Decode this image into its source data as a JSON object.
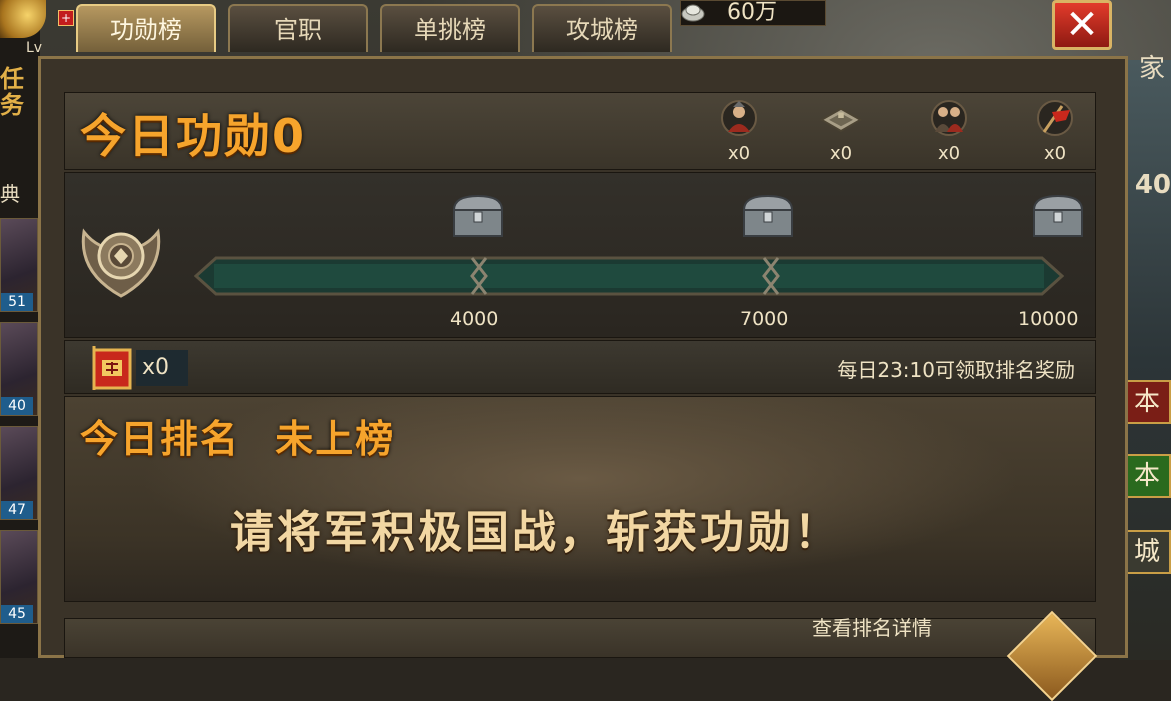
{
  "tabs": [
    {
      "label": "功勋榜",
      "active": true
    },
    {
      "label": "官职",
      "active": false
    },
    {
      "label": "单挑榜",
      "active": false
    },
    {
      "label": "攻城榜",
      "active": false
    }
  ],
  "resource": {
    "value": "60万"
  },
  "left_bar": {
    "level_text": "Lv",
    "task_text": "任务",
    "dian_text": "典",
    "plus": "+",
    "heroes": [
      {
        "level": "51"
      },
      {
        "level": "40"
      },
      {
        "level": "47"
      },
      {
        "level": "45"
      }
    ]
  },
  "right_bar": {
    "top_char": "家",
    "level": "40",
    "tags": [
      "本",
      "本",
      "城"
    ]
  },
  "merit": {
    "title": "今日功勋",
    "value": "0"
  },
  "stats": [
    {
      "icon": "general-icon",
      "count": "x0"
    },
    {
      "icon": "fortress-icon",
      "count": "x0"
    },
    {
      "icon": "soldiers-icon",
      "count": "x0"
    },
    {
      "icon": "war-flag-icon",
      "count": "x0"
    }
  ],
  "progress": {
    "current": 0,
    "max": 10000,
    "milestones": [
      {
        "value": "4000"
      },
      {
        "value": "7000"
      },
      {
        "value": "10000"
      }
    ]
  },
  "flag_item": {
    "count": "x0"
  },
  "reward_notice": "每日23:10可领取排名奖励",
  "rank": {
    "title": "今日排名",
    "status": "未上榜"
  },
  "slogan": "请将军积极国战，斩获功勋！",
  "detail_link": "查看排名详情",
  "colors": {
    "accent": "#f6a42c",
    "close": "#e23b2b",
    "bar": "#1e4a3c"
  }
}
